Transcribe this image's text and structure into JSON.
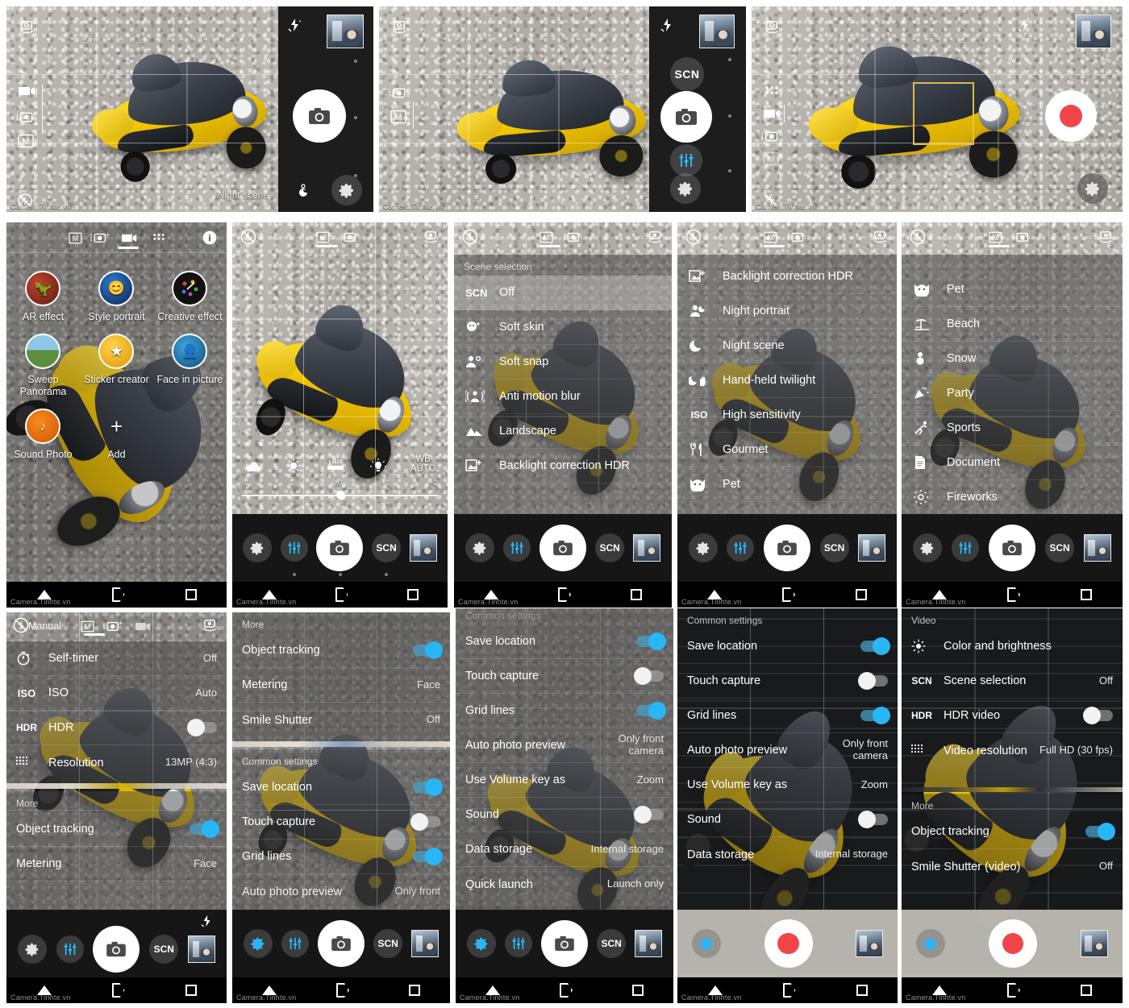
{
  "watermark": "Camera.Tinhte.vn",
  "panels": {
    "r1p1": {
      "name": "manual-landscape-preview",
      "scene_label": "Night scene",
      "left_icons": [
        "switch-camera-icon",
        "video-mode-icon",
        "iauto-mode-icon",
        "manual-mode-icon",
        "flash-off-icon"
      ],
      "rail_icons": [
        "front-flash-icon",
        "thumbnail",
        "night-scene-icon",
        "settings-gear-icon"
      ],
      "shutter": "photo-shutter-button"
    },
    "r1p2": {
      "name": "manual-landscape-scn-preview",
      "left_icons": [
        "switch-camera-icon",
        "iauto-mode-icon",
        "manual-mode-icon"
      ],
      "rail_labels": {
        "scn": "SCN"
      },
      "rail_icons": [
        "front-flash-icon",
        "thumbnail",
        "scn-button",
        "sliders-icon",
        "settings-gear-icon"
      ],
      "shutter": "photo-shutter-button"
    },
    "r1p3": {
      "name": "video-landscape-preview",
      "left_icons": [
        "switch-camera-icon",
        "apps-grid-icon",
        "video-mode-icon",
        "iauto-mode-icon",
        "manual-mode-icon",
        "flash-off-icon"
      ],
      "rail_icons": [
        "front-flash-icon",
        "thumbnail",
        "settings-gear-icon"
      ],
      "shutter": "video-record-button"
    },
    "r2p1": {
      "name": "camera-apps-grid",
      "modebar": [
        "manual-mode-icon",
        "iauto-mode-icon",
        "video-mode-icon",
        "apps-grid-icon"
      ],
      "info_icon": "info-icon",
      "apps": [
        {
          "label": "AR effect",
          "icon": "ar-effect-icon"
        },
        {
          "label": "Style portrait",
          "icon": "style-portrait-icon"
        },
        {
          "label": "Creative effect",
          "icon": "creative-effect-icon"
        },
        {
          "label": "Sweep\nPanorama",
          "icon": "sweep-panorama-icon"
        },
        {
          "label": "Sticker creator",
          "icon": "sticker-creator-icon"
        },
        {
          "label": "Face in picture",
          "icon": "face-in-picture-icon"
        },
        {
          "label": "Sound Photo",
          "icon": "sound-photo-icon"
        },
        {
          "label": "Add",
          "icon": "add-icon"
        }
      ]
    },
    "r2p2": {
      "name": "manual-mode-portrait",
      "modebar": [
        "manual-mode-icon",
        "iauto-mode-icon"
      ],
      "flash_icon": "flash-off-icon",
      "switch_icon": "switch-camera-icon",
      "wb_presets": [
        "cloudy-icon",
        "daylight-icon",
        "fluorescent-icon",
        "incandescent-icon"
      ],
      "wb_label": "WB\nAUTO",
      "ev_ticks": [
        "-2",
        "-1",
        "±0",
        "+1",
        "+2"
      ],
      "controls": {
        "gear": "settings-gear-icon",
        "sliders": "sliders-icon",
        "shutter": "photo-shutter-button",
        "scn": "SCN",
        "thumb": "thumbnail"
      },
      "page_dots": 3
    },
    "r2p3": {
      "name": "scene-selection-list-top",
      "section_title": "Scene selection",
      "items": [
        {
          "icon": "SCN",
          "label": "Off",
          "selected": true
        },
        {
          "icon": "soft-skin-icon",
          "label": "Soft skin",
          "selected": false
        },
        {
          "icon": "soft-snap-icon",
          "label": "Soft snap",
          "selected": false
        },
        {
          "icon": "anti-motion-blur-icon",
          "label": "Anti motion blur",
          "selected": false
        },
        {
          "icon": "landscape-icon",
          "label": "Landscape",
          "selected": false
        },
        {
          "icon": "backlight-hdr-icon",
          "label": "Backlight correction HDR",
          "selected": false
        }
      ],
      "controls": {
        "gear": "settings-gear-icon",
        "sliders": "sliders-icon",
        "shutter": "photo-shutter-button",
        "scn": "SCN",
        "thumb": "thumbnail"
      }
    },
    "r2p4": {
      "name": "scene-selection-list-middle",
      "items": [
        {
          "icon": "backlight-hdr-icon",
          "label": "Backlight correction HDR"
        },
        {
          "icon": "night-portrait-icon",
          "label": "Night portrait"
        },
        {
          "icon": "night-scene-icon",
          "label": "Night scene"
        },
        {
          "icon": "handheld-twilight-icon",
          "label": "Hand-held twilight"
        },
        {
          "icon": "ISO",
          "label": "High sensitivity"
        },
        {
          "icon": "gourmet-icon",
          "label": "Gourmet"
        },
        {
          "icon": "pet-icon",
          "label": "Pet"
        }
      ],
      "controls": {
        "gear": "settings-gear-icon",
        "sliders": "sliders-icon",
        "shutter": "photo-shutter-button",
        "scn": "SCN",
        "thumb": "thumbnail"
      }
    },
    "r2p5": {
      "name": "scene-selection-list-bottom",
      "items": [
        {
          "icon": "pet-icon",
          "label": "Pet"
        },
        {
          "icon": "beach-icon",
          "label": "Beach"
        },
        {
          "icon": "snow-icon",
          "label": "Snow"
        },
        {
          "icon": "party-icon",
          "label": "Party"
        },
        {
          "icon": "sports-icon",
          "label": "Sports"
        },
        {
          "icon": "document-icon",
          "label": "Document"
        },
        {
          "icon": "fireworks-icon",
          "label": "Fireworks"
        }
      ],
      "controls": {
        "gear": "settings-gear-icon",
        "sliders": "sliders-icon",
        "shutter": "photo-shutter-button",
        "scn": "SCN",
        "thumb": "thumbnail"
      }
    },
    "r3p1": {
      "name": "manual-settings-top",
      "mode_label": "Manual",
      "modebar": [
        "manual-mode-icon",
        "iauto-mode-icon",
        "video-mode-icon"
      ],
      "rows": [
        {
          "icon": "self-timer-icon",
          "label": "Self-timer",
          "value": "Off",
          "type": "value"
        },
        {
          "icon": "ISO",
          "label": "ISO",
          "value": "Auto",
          "type": "value"
        },
        {
          "icon": "HDR",
          "label": "HDR",
          "value": "off",
          "type": "toggle"
        },
        {
          "icon": "resolution-icon",
          "label": "Resolution",
          "value": "13MP (4:3)",
          "type": "value"
        }
      ],
      "section_more": "More",
      "more_rows": [
        {
          "icon": "",
          "label": "Object tracking",
          "value": "on",
          "type": "toggle"
        },
        {
          "icon": "",
          "label": "Metering",
          "value": "Face",
          "type": "value"
        }
      ],
      "controls": {
        "gear": "settings-gear-icon",
        "sliders": "sliders-icon",
        "shutter": "photo-shutter-button",
        "scn": "SCN",
        "thumb": "thumbnail"
      }
    },
    "r3p2": {
      "name": "manual-settings-more",
      "section_more": "More",
      "more_rows": [
        {
          "label": "Object tracking",
          "value": "on",
          "type": "toggle"
        },
        {
          "label": "Metering",
          "value": "Face",
          "type": "value"
        },
        {
          "label": "Smile Shutter",
          "value": "Off",
          "type": "value"
        }
      ],
      "section_common": "Common settings",
      "common_rows": [
        {
          "label": "Save location",
          "value": "on",
          "type": "toggle"
        },
        {
          "label": "Touch capture",
          "value": "off",
          "type": "toggle"
        },
        {
          "label": "Grid lines",
          "value": "on",
          "type": "toggle"
        },
        {
          "label": "Auto photo preview",
          "value": "Only front",
          "type": "value"
        }
      ],
      "controls": {
        "gear": "settings-gear-icon",
        "sliders": "sliders-icon",
        "shutter": "photo-shutter-button",
        "scn": "SCN",
        "thumb": "thumbnail"
      }
    },
    "r3p3": {
      "name": "common-settings-photo",
      "section_common": "Common settings",
      "common_rows": [
        {
          "label": "Save location",
          "value": "on",
          "type": "toggle"
        },
        {
          "label": "Touch capture",
          "value": "off",
          "type": "toggle"
        },
        {
          "label": "Grid lines",
          "value": "on",
          "type": "toggle"
        },
        {
          "label": "Auto photo preview",
          "value": "Only front\ncamera",
          "type": "value"
        },
        {
          "label": "Use Volume key as",
          "value": "Zoom",
          "type": "value"
        },
        {
          "label": "Sound",
          "value": "off",
          "type": "toggle"
        },
        {
          "label": "Data storage",
          "value": "Internal storage",
          "type": "value"
        },
        {
          "label": "Quick launch",
          "value": "Launch only",
          "type": "value"
        }
      ],
      "controls": {
        "gear": "settings-gear-icon",
        "sliders": "sliders-icon",
        "shutter": "photo-shutter-button",
        "scn": "SCN",
        "thumb": "thumbnail"
      }
    },
    "r3p4": {
      "name": "common-settings-video",
      "section_common": "Common settings",
      "common_rows": [
        {
          "label": "Save location",
          "value": "on",
          "type": "toggle"
        },
        {
          "label": "Touch capture",
          "value": "off",
          "type": "toggle"
        },
        {
          "label": "Grid lines",
          "value": "on",
          "type": "toggle"
        },
        {
          "label": "Auto photo preview",
          "value": "Only front\ncamera",
          "type": "value"
        },
        {
          "label": "Use Volume key as",
          "value": "Zoom",
          "type": "value"
        },
        {
          "label": "Sound",
          "value": "off",
          "type": "toggle"
        },
        {
          "label": "Data storage",
          "value": "Internal storage",
          "type": "value"
        }
      ],
      "controls": {
        "gear": "settings-gear-icon",
        "shutter": "video-record-button",
        "thumb": "thumbnail"
      }
    },
    "r3p5": {
      "name": "video-settings",
      "section_title": "Video",
      "rows": [
        {
          "icon": "color-brightness-icon",
          "label": "Color and brightness",
          "value": "",
          "type": "value"
        },
        {
          "icon": "SCN",
          "label": "Scene selection",
          "value": "Off",
          "type": "value"
        },
        {
          "icon": "HDR",
          "label": "HDR video",
          "value": "off",
          "type": "toggle"
        },
        {
          "icon": "resolution-icon",
          "label": "Video resolution",
          "value": "Full HD (30 fps)",
          "type": "value"
        }
      ],
      "section_more": "More",
      "more_rows": [
        {
          "label": "Object tracking",
          "value": "on",
          "type": "toggle"
        },
        {
          "label": "Smile Shutter (video)",
          "value": "Off",
          "type": "value"
        }
      ],
      "controls": {
        "gear": "settings-gear-icon",
        "shutter": "video-record-button",
        "thumb": "thumbnail"
      }
    }
  },
  "colors": {
    "accent_blue": "#29b6f6",
    "record_red": "#f0464a",
    "rail_dark": "#1d1d1d",
    "sheet_grey": "#6e6e6e"
  }
}
